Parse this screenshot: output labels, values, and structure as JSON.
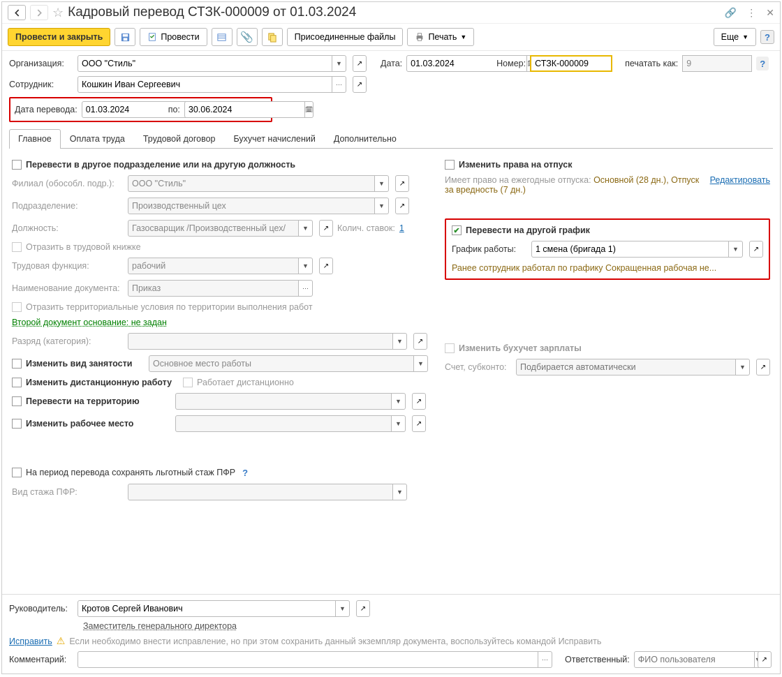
{
  "title": "Кадровый перевод СТЗК-000009 от 01.03.2024",
  "toolbar": {
    "post_close": "Провести и закрыть",
    "post": "Провести",
    "attached": "Присоединенные файлы",
    "print": "Печать",
    "more": "Еще"
  },
  "fields": {
    "org_label": "Организация:",
    "org": "ООО \"Стиль\"",
    "date_label": "Дата:",
    "date": "01.03.2024",
    "number_label": "Номер:",
    "number": "СТЗК-000009",
    "print_as_label": "печатать как:",
    "print_as": "9",
    "employee_label": "Сотрудник:",
    "employee": "Кошкин Иван Сергеевич",
    "transfer_date_label": "Дата перевода:",
    "transfer_from": "01.03.2024",
    "to_label": "по:",
    "transfer_to": "30.06.2024"
  },
  "tabs": {
    "main": "Главное",
    "pay": "Оплата труда",
    "contract": "Трудовой договор",
    "accounting": "Бухучет начислений",
    "extra": "Дополнительно"
  },
  "main": {
    "transfer_dept_chk": "Перевести в другое подразделение или на другую должность",
    "branch_label": "Филиал (обособл. подр.):",
    "branch": "ООО \"Стиль\"",
    "dept_label": "Подразделение:",
    "dept": "Производственный цех",
    "position_label": "Должность:",
    "position": "Газосварщик /Производственный цех/",
    "rates_label": "Колич. ставок:",
    "rates": "1",
    "workbook_chk": "Отразить в трудовой книжке",
    "func_label": "Трудовая функция:",
    "func": "рабочий",
    "docname_label": "Наименование документа:",
    "docname": "Приказ",
    "territory_chk": "Отразить территориальные условия по территории выполнения работ",
    "second_doc": "Второй документ основание: не задан",
    "category_label": "Разряд (категория):",
    "employment_chk": "Изменить вид занятости",
    "employment": "Основное место работы",
    "remote_chk": "Изменить дистанционную работу",
    "remote_work_chk": "Работает дистанционно",
    "territory_transfer_chk": "Перевести на территорию",
    "workplace_chk": "Изменить рабочее место",
    "pfr_chk": "На период перевода сохранять льготный стаж ПФР",
    "pfr_type_label": "Вид стажа ПФР:",
    "vacation_chk": "Изменить права на отпуск",
    "vacation_text1": "Имеет право на ежегодные отпуска: ",
    "vacation_text2": "Основной (28 дн.), Отпуск за вредность (7 дн.)",
    "vacation_edit": "Редактировать",
    "schedule_chk": "Перевести на другой график",
    "schedule_label": "График работы:",
    "schedule": "1 смена (бригада 1)",
    "schedule_note": "Ранее сотрудник работал по графику Сокращенная рабочая не...",
    "accounting_chk": "Изменить бухучет зарплаты",
    "account_label": "Счет, субконто:",
    "account_ph": "Подбирается автоматически"
  },
  "bottom": {
    "head_label": "Руководитель:",
    "head": "Кротов Сергей Иванович",
    "head_pos": "Заместитель генерального директора",
    "fix_link": "Исправить",
    "fix_text": "Если необходимо внести исправление, но при этом сохранить данный экземпляр документа, воспользуйтесь командой Исправить",
    "comment_label": "Комментарий:",
    "resp_label": "Ответственный:",
    "resp_ph": "ФИО пользователя"
  }
}
